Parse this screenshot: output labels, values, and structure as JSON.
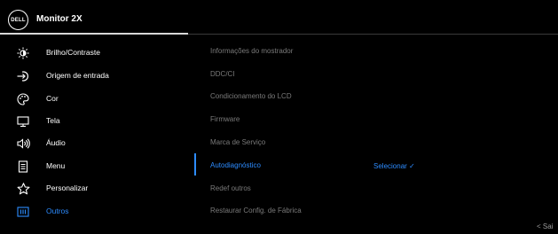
{
  "header": {
    "logo_text": "DELL",
    "title": "Monitor 2X"
  },
  "menu": {
    "items": [
      {
        "label": "Brilho/Contraste",
        "icon": "brightness-icon"
      },
      {
        "label": "Origem de entrada",
        "icon": "input-source-icon"
      },
      {
        "label": "Cor",
        "icon": "color-palette-icon"
      },
      {
        "label": "Tela",
        "icon": "display-icon"
      },
      {
        "label": "Áudio",
        "icon": "speaker-icon"
      },
      {
        "label": "Menu",
        "icon": "menu-list-icon"
      },
      {
        "label": "Personalizar",
        "icon": "star-icon"
      },
      {
        "label": "Outros",
        "icon": "others-icon",
        "active": true
      }
    ]
  },
  "submenu": {
    "items": [
      {
        "label": "Informações do mostrador"
      },
      {
        "label": "DDC/CI"
      },
      {
        "label": "Condicionamento do LCD"
      },
      {
        "label": "Firmware"
      },
      {
        "label": "Marca de Serviço"
      },
      {
        "label": "Autodiagnóstico",
        "active": true
      },
      {
        "label": "Redef outros"
      },
      {
        "label": "Restaurar Config. de Fábrica"
      }
    ],
    "action_label": "Selecionar ✓"
  },
  "footer": {
    "exit_label": "< Sai"
  },
  "colors": {
    "accent": "#2d8cff",
    "background": "#000000",
    "inactive_text": "#7a7a7a"
  }
}
